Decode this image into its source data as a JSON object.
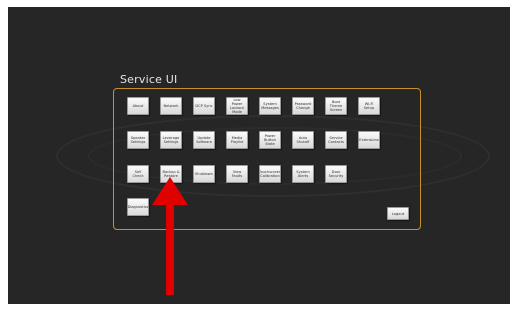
{
  "page": {
    "title": "Service UI"
  },
  "buttons": {
    "row1": [
      "About",
      "Network",
      "DCP Sync",
      "Low Power Lockout Mode",
      "System Messages",
      "Password Change",
      "Boot Theme Screen",
      "Wi-Fi Setup"
    ],
    "row2": [
      "Speaker Settings",
      "Leverage Settings",
      "Update Software",
      "Media Playlist",
      "Power Button State",
      "Auto Shutoff",
      "Service Contacts",
      "Extensions"
    ],
    "row3": [
      "Self Check",
      "Backup & Restore",
      "Shutdown",
      "View Faults",
      "Touchscreen Calibration",
      "System Alerts",
      "Door Security"
    ],
    "row4": [
      "Diagnostics"
    ],
    "logout": "Logout"
  },
  "annotation": {
    "arrow_color": "#e00000",
    "points_to": "Backup & Restore"
  },
  "colors": {
    "background": "#262626",
    "panel_border": "#c8902c",
    "button_face": "#f2f2f2"
  }
}
